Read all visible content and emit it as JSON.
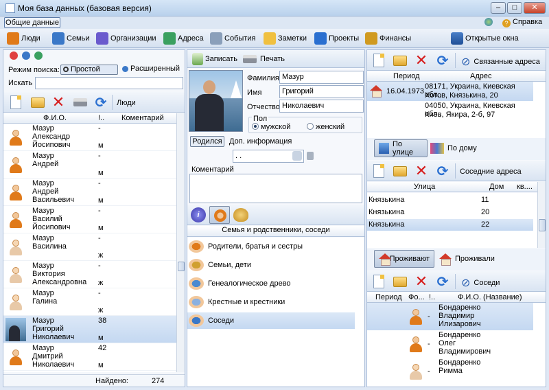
{
  "window": {
    "title": "Моя база данных (базовая версия)"
  },
  "menu": {
    "general": "Общие данные",
    "help": "Справка"
  },
  "nav": {
    "items": [
      {
        "label": "Люди",
        "icon": "people-icon"
      },
      {
        "label": "Семьи",
        "icon": "family-icon"
      },
      {
        "label": "Организации",
        "icon": "organizations-icon"
      },
      {
        "label": "Адреса",
        "icon": "addresses-icon"
      },
      {
        "label": "События",
        "icon": "calendar-icon"
      },
      {
        "label": "Заметки",
        "icon": "note-icon"
      },
      {
        "label": "Проекты",
        "icon": "projects-icon"
      },
      {
        "label": "Финансы",
        "icon": "money-bag-icon"
      }
    ],
    "open_windows": "Открытые окна"
  },
  "left": {
    "search_mode_label": "Режим поиска:",
    "mode_simple": "Простой",
    "mode_advanced": "Расширенный",
    "search_label": "Искать",
    "search_value": "",
    "toolbar_label": "Люди",
    "columns": [
      "Ф.И.О.",
      "!..",
      "Коментарий"
    ],
    "rows": [
      {
        "lines": [
          "Мазур",
          "Александр",
          "Йосипович"
        ],
        "dash": "-",
        "gender": "м",
        "female": false,
        "photo": false,
        "selected": false
      },
      {
        "lines": [
          "Мазур",
          "Андрей",
          ""
        ],
        "dash": "-",
        "gender": "м",
        "female": false,
        "photo": false,
        "selected": false
      },
      {
        "lines": [
          "Мазур",
          "Андрей",
          "Васильевич"
        ],
        "dash": "-",
        "gender": "м",
        "female": false,
        "photo": false,
        "selected": false
      },
      {
        "lines": [
          "Мазур",
          "Василий",
          "Йосипович"
        ],
        "dash": "-",
        "gender": "м",
        "female": false,
        "photo": false,
        "selected": false
      },
      {
        "lines": [
          "Мазур",
          "Василина",
          ""
        ],
        "dash": "-",
        "gender": "ж",
        "female": true,
        "photo": false,
        "selected": false
      },
      {
        "lines": [
          "Мазур",
          "Виктория",
          "Александровна"
        ],
        "dash": "-",
        "gender": "ж",
        "female": true,
        "photo": false,
        "selected": false
      },
      {
        "lines": [
          "Мазур",
          "Галина",
          ""
        ],
        "dash": "-",
        "gender": "ж",
        "female": true,
        "photo": false,
        "selected": false
      },
      {
        "lines": [
          "Мазур",
          "Григорий",
          "Николаевич"
        ],
        "dash": "38",
        "gender": "м",
        "female": false,
        "photo": true,
        "selected": true
      },
      {
        "lines": [
          "Мазур",
          "Дмитрий",
          "Николаевич"
        ],
        "dash": "42",
        "gender": "м",
        "female": false,
        "photo": false,
        "selected": false
      }
    ],
    "found_label": "Найдено:",
    "found_count": "274"
  },
  "mid": {
    "save": "Записать",
    "print": "Печать",
    "surname_label": "Фамилия",
    "surname": "Мазур",
    "name_label": "Имя",
    "name": "Григорий",
    "patronymic_label": "Отчество",
    "patronymic": "Николаевич",
    "sex_label": "Пол",
    "male": "мужской",
    "female": "женский",
    "born_btn": "Родился",
    "extra_info": "Доп. информация",
    "date_value": " .  .",
    "comment_label": "Коментарий",
    "comment": "",
    "relations_header": "Семья и родственники, соседи",
    "relations": [
      {
        "label": "Родители, братья и сестры",
        "icon": "parents-icon",
        "selected": false
      },
      {
        "label": "Семьи, дети",
        "icon": "rings-icon",
        "selected": false
      },
      {
        "label": "Генеалогическое древо",
        "icon": "family-tree-icon",
        "selected": false
      },
      {
        "label": "Крестные и крестники",
        "icon": "godparents-icon",
        "selected": false
      },
      {
        "label": "Соседи",
        "icon": "neighbors-icon",
        "selected": true
      }
    ]
  },
  "right": {
    "linked_addresses": "Связанные адреса",
    "addr_columns": [
      "Период",
      "Адрес"
    ],
    "addresses": [
      {
        "period": "16.04.1973",
        "lines": [
          "08171, Украина, Киевская обл.,",
          "Хотов, Князькина, 20"
        ],
        "selected": true
      },
      {
        "period": "",
        "lines": [
          "04050, Украина, Киевская обл.,",
          "Киев, Якира, 2-б, 97"
        ],
        "selected": false
      }
    ],
    "by_street": "По улице",
    "by_house": "По дому",
    "nearby": "Соседние адреса",
    "street_columns": [
      "Улица",
      "Дом",
      "кв...."
    ],
    "streets": [
      {
        "street": "Князькина",
        "house": "11",
        "apt": "",
        "selected": false
      },
      {
        "street": "Князькина",
        "house": "20",
        "apt": "",
        "selected": false
      },
      {
        "street": "Князькина",
        "house": "22",
        "apt": "",
        "selected": true
      }
    ],
    "living": "Проживают",
    "lived": "Проживали",
    "neighbors": "Соседи",
    "nb_columns": [
      "Период",
      "Фо...",
      "!..",
      "Ф.И.О. (Название)"
    ],
    "neighbor_rows": [
      {
        "dash": "-",
        "lines": [
          "Бондаренко",
          "Владимир",
          "Илизарович"
        ],
        "female": false,
        "selected": true
      },
      {
        "dash": "-",
        "lines": [
          "Бондаренко",
          "Олег",
          "Владимирович"
        ],
        "female": false,
        "selected": false
      },
      {
        "dash": "-",
        "lines": [
          "Бондаренко",
          "Римма",
          ""
        ],
        "female": true,
        "selected": false
      }
    ]
  },
  "colors": {
    "accent": "#c4d8f1",
    "border": "#a9bcd8",
    "delete": "#d61e1e"
  }
}
